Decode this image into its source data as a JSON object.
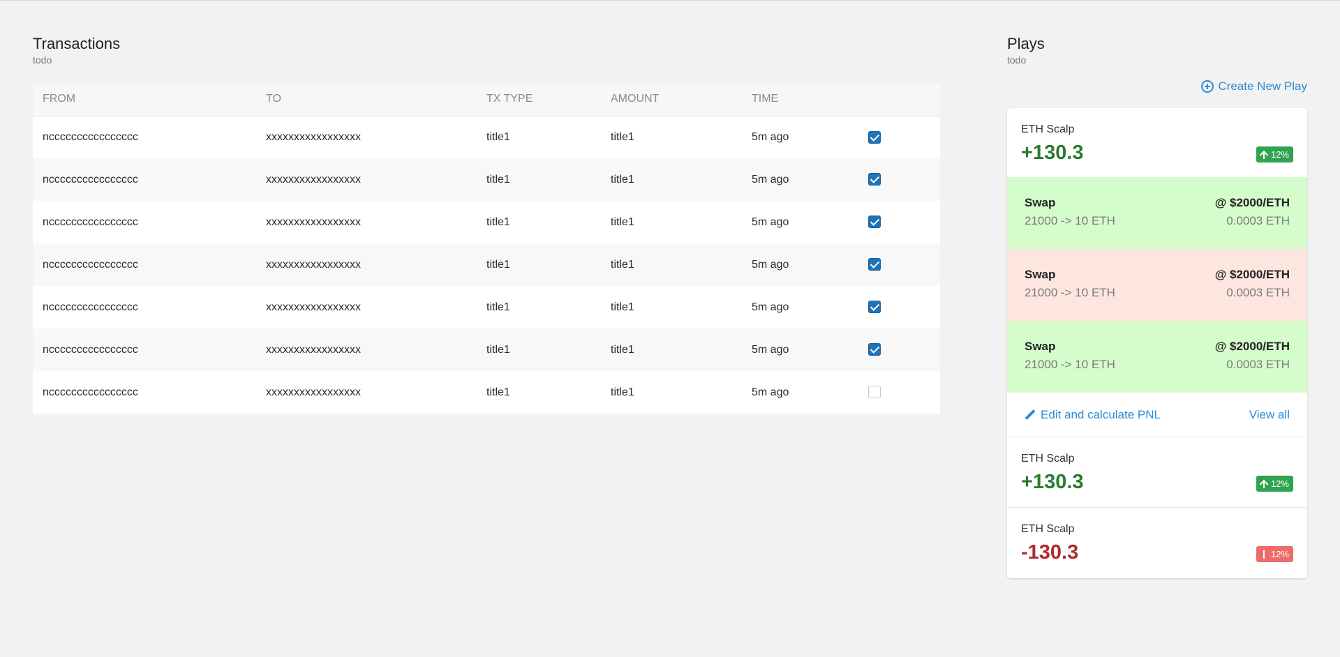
{
  "transactions": {
    "title": "Transactions",
    "subtitle": "todo",
    "columns": [
      "FROM",
      "TO",
      "TX TYPE",
      "AMOUNT",
      "TIME",
      ""
    ],
    "rows": [
      {
        "from": "ncccccccccccccccc",
        "to": "xxxxxxxxxxxxxxxxx",
        "tx_type": "title1",
        "amount": "title1",
        "time": "5m ago",
        "checked": true
      },
      {
        "from": "ncccccccccccccccc",
        "to": "xxxxxxxxxxxxxxxxx",
        "tx_type": "title1",
        "amount": "title1",
        "time": "5m ago",
        "checked": true
      },
      {
        "from": "ncccccccccccccccc",
        "to": "xxxxxxxxxxxxxxxxx",
        "tx_type": "title1",
        "amount": "title1",
        "time": "5m ago",
        "checked": true
      },
      {
        "from": "ncccccccccccccccc",
        "to": "xxxxxxxxxxxxxxxxx",
        "tx_type": "title1",
        "amount": "title1",
        "time": "5m ago",
        "checked": true
      },
      {
        "from": "ncccccccccccccccc",
        "to": "xxxxxxxxxxxxxxxxx",
        "tx_type": "title1",
        "amount": "title1",
        "time": "5m ago",
        "checked": true
      },
      {
        "from": "ncccccccccccccccc",
        "to": "xxxxxxxxxxxxxxxxx",
        "tx_type": "title1",
        "amount": "title1",
        "time": "5m ago",
        "checked": true
      },
      {
        "from": "ncccccccccccccccc",
        "to": "xxxxxxxxxxxxxxxxx",
        "tx_type": "title1",
        "amount": "title1",
        "time": "5m ago",
        "checked": false
      }
    ]
  },
  "plays": {
    "title": "Plays",
    "subtitle": "todo",
    "create_label": "Create New Play",
    "create_icon": "plus-circle-icon",
    "cards": [
      {
        "name": "ETH Scalp",
        "value": "+130.3",
        "change": "12%",
        "direction": "up"
      },
      {
        "name": "ETH Scalp",
        "value": "+130.3",
        "change": "12%",
        "direction": "up"
      },
      {
        "name": "ETH Scalp",
        "value": "-130.3",
        "change": "12%",
        "direction": "down"
      }
    ],
    "swaps": [
      {
        "title": "Swap",
        "detail": "21000 -> 10 ETH",
        "price": "@ $2000/ETH",
        "fee": "0.0003 ETH",
        "status": "green"
      },
      {
        "title": "Swap",
        "detail": "21000 -> 10 ETH",
        "price": "@ $2000/ETH",
        "fee": "0.0003 ETH",
        "status": "red"
      },
      {
        "title": "Swap",
        "detail": "21000 -> 10 ETH",
        "price": "@ $2000/ETH",
        "fee": "0.0003 ETH",
        "status": "green"
      }
    ],
    "edit_label": "Edit and calculate PNL",
    "edit_icon": "pencil-icon",
    "view_all_label": "View all"
  },
  "colors": {
    "accent": "#2a8bd4",
    "positive": "#2c7a2e",
    "negative": "#b02a2a",
    "swap_green_bg": "#d5fccb",
    "swap_red_bg": "#fde6df",
    "badge_up": "#2ea44f",
    "badge_down": "#ef6b6b",
    "checkbox": "#1f73b7"
  }
}
